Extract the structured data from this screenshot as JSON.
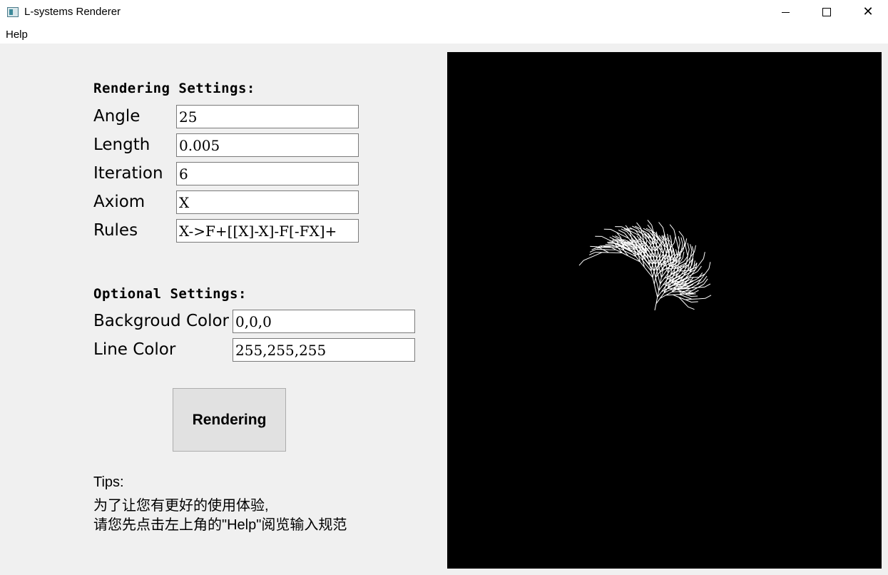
{
  "window": {
    "title": "L-systems Renderer",
    "controls": {
      "minimize": "—",
      "maximize": "☐",
      "close": "✕"
    }
  },
  "menu": {
    "help": "Help"
  },
  "rendering_settings": {
    "heading": "Rendering Settings:",
    "angle": {
      "label": "Angle",
      "value": "25"
    },
    "length": {
      "label": "Length",
      "value": "0.005"
    },
    "iteration": {
      "label": "Iteration",
      "value": "6"
    },
    "axiom": {
      "label": "Axiom",
      "value": "X"
    },
    "rules": {
      "label": "Rules",
      "value": "X->F+[[X]-X]-F[-FX]+"
    }
  },
  "optional_settings": {
    "heading": "Optional Settings:",
    "background_color": {
      "label": "Backgroud Color",
      "value": "0,0,0"
    },
    "line_color": {
      "label": "Line Color",
      "value": "255,255,255"
    }
  },
  "render_button": {
    "label": "Rendering"
  },
  "tips": {
    "title": "Tips:",
    "line1": "为了让您有更好的使用体验,",
    "line2": "请您先点击左上角的\"Help\"阅览输入规范"
  },
  "canvas": {
    "background": "#000000",
    "line_color": "#ffffff",
    "content": "l-system-fractal-plant"
  },
  "colors": {
    "window_bg": "#f0f0f0",
    "titlebar_bg": "#ffffff",
    "button_bg": "#e1e1e1"
  }
}
